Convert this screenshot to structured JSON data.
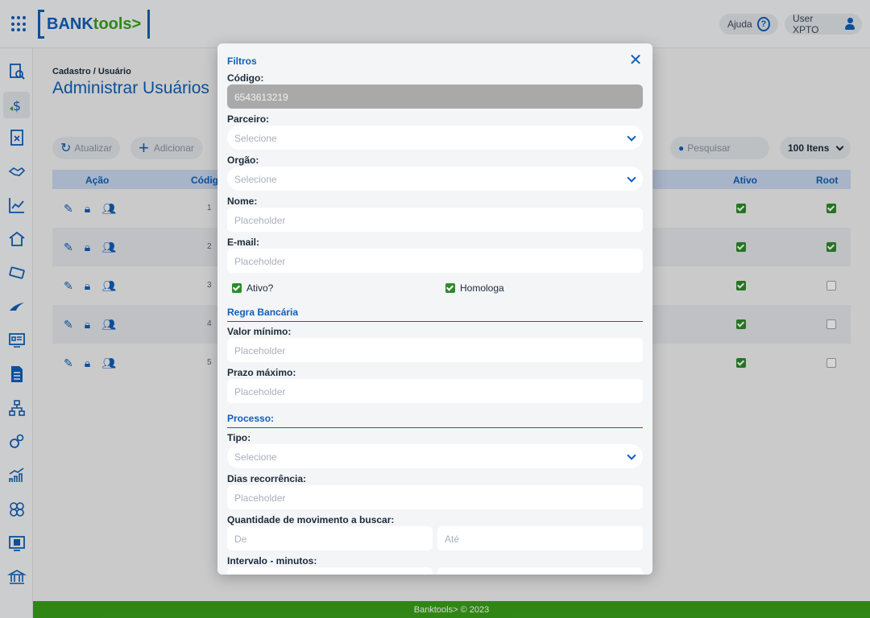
{
  "header": {
    "logo_bank": "BANK",
    "logo_tools": "tools>",
    "help_label": "Ajuda",
    "help_icon_text": "?",
    "user_label": "User XPTO"
  },
  "page": {
    "breadcrumb": "Cadastro / Usuário",
    "title": "Administrar Usuários"
  },
  "toolbar": {
    "refresh_label": "Atualizar",
    "add_label": "Adicionar",
    "search_placeholder": "Pesquisar",
    "items_label": "100 Itens"
  },
  "table": {
    "columns": [
      "Ação",
      "Código",
      "Ativo",
      "Root"
    ],
    "rows": [
      {
        "code": "1",
        "ativo": true,
        "root": true
      },
      {
        "code": "2",
        "ativo": true,
        "root": true
      },
      {
        "code": "3",
        "ativo": true,
        "root": false
      },
      {
        "code": "4",
        "ativo": true,
        "root": false
      },
      {
        "code": "5",
        "ativo": true,
        "root": false
      }
    ]
  },
  "modal": {
    "title": "Filtros",
    "codigo_label": "Código:",
    "codigo_value": "6543613219",
    "parceiro_label": "Parceiro:",
    "parceiro_value": "Selecione",
    "orgao_label": "Orgão:",
    "orgao_value": "Selecione",
    "nome_label": "Nome:",
    "nome_placeholder": "Placeholder",
    "email_label": "E-mail:",
    "email_placeholder": "Placeholder",
    "ativo_label": "Ativo?",
    "homologa_label": "Homologa",
    "section_regra": "Regra Bancária",
    "valor_label": "Valor mínimo:",
    "valor_placeholder": "Placeholder",
    "prazo_label": "Prazo máximo:",
    "prazo_placeholder": "Placeholder",
    "section_processo": "Processo:",
    "tipo_label": "Tipo:",
    "tipo_value": "Selecione",
    "dias_label": "Dias recorrência:",
    "dias_placeholder": "Placeholder",
    "qtd_label": "Quantidade de movimento a buscar:",
    "qtd_de": "De",
    "qtd_ate": "Até",
    "intervalo_label": "Intervalo - minutos:"
  },
  "footer": {
    "text": "Banktools>  ©  2023"
  },
  "colors": {
    "primary": "#0f5fb8",
    "brand_green": "#3aa01a",
    "check_green": "#2e8b2a"
  }
}
